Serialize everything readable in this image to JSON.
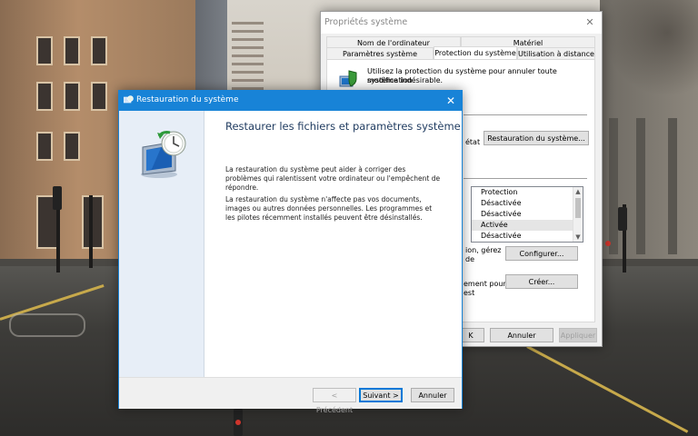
{
  "sysprops": {
    "title": "Propriétés système",
    "tabs_top": [
      "Nom de l'ordinateur",
      "Matériel"
    ],
    "tabs_bottom": [
      "Paramètres système avancés",
      "Protection du système",
      "Utilisation à distance"
    ],
    "intro_line1": "Utilisez la protection du système pour annuler toute modification",
    "intro_line2": "système indésirable.",
    "restore_partial": "état",
    "restore_button": "Restauration du système...",
    "list_header": "Protection",
    "list_items": [
      "Désactivée",
      "Désactivée",
      "Activée",
      "Désactivée"
    ],
    "configure_text1": "ion, gérez",
    "configure_text2": "de",
    "configure_button": "Configurer...",
    "create_text1": "ement pour",
    "create_text2": "est",
    "create_button": "Créer...",
    "ok_partial": "K",
    "cancel_button": "Annuler",
    "apply_button": "Appliquer"
  },
  "wizard": {
    "title": "Restauration du système",
    "heading": "Restaurer les fichiers et paramètres système",
    "para1": "La restauration du système peut aider à corriger des problèmes qui ralentissent votre ordinateur ou l'empêchent de répondre.",
    "para2": "La restauration du système n'affecte pas vos documents, images ou autres données personnelles. Les programmes et les pilotes récemment installés peuvent être désinstallés.",
    "back_button": "< Précédent",
    "next_button": "Suivant >",
    "cancel_button": "Annuler"
  },
  "colors": {
    "accent": "#1883d7",
    "window_bg": "#f0f0f0",
    "wizard_side": "#e7eef7"
  }
}
